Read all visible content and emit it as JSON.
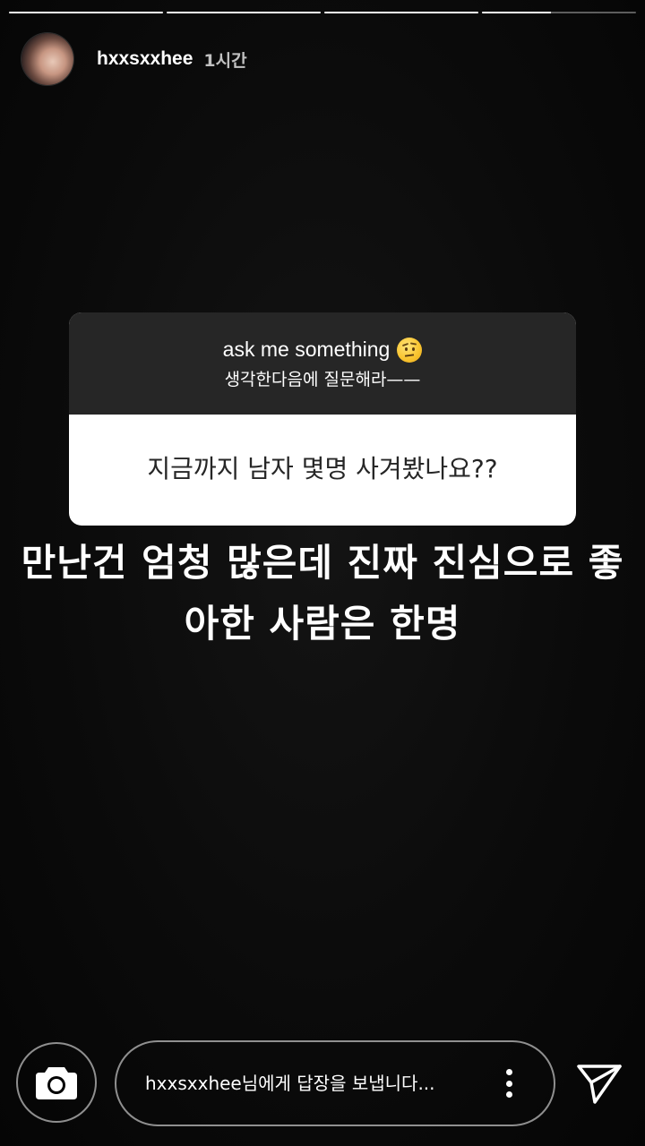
{
  "story": {
    "progress": [
      1,
      1,
      1,
      0.45
    ],
    "user": {
      "username": "hxxsxxhee",
      "time_ago": "1시간"
    },
    "question_sticker": {
      "prompt": "ask me something",
      "prompt_emoji": "face-with-raised-eyebrow",
      "subtitle": "생각한다음에 질문해라——",
      "question": "지금까지 남자 몇명 사겨봤나요??"
    },
    "answer_text": "만난건 엄청 많은데 진짜 진심으로 좋아한 사람은 한명"
  },
  "footer": {
    "camera_icon": "camera-icon",
    "reply_placeholder": "hxxsxxhee님에게 답장을 보냅니다...",
    "more_icon": "more-vertical-icon",
    "send_icon": "send-icon"
  }
}
